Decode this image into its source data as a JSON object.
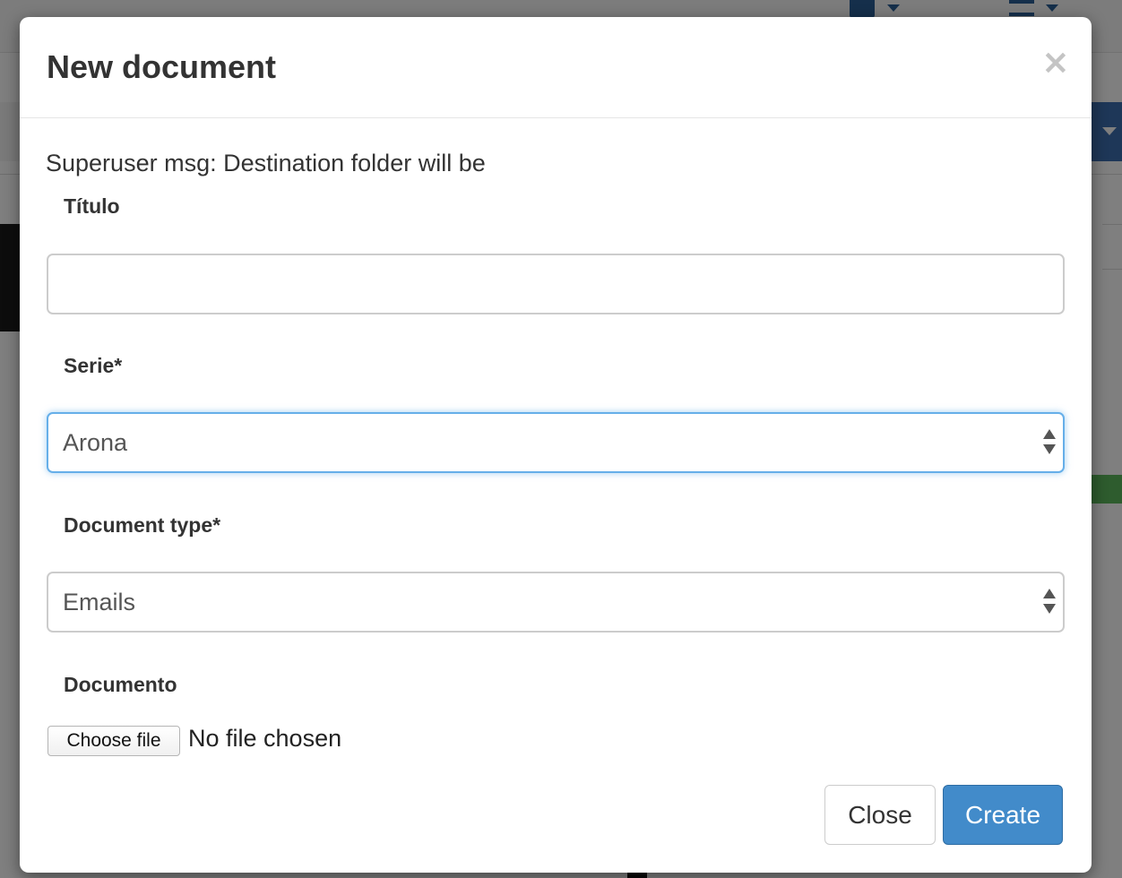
{
  "modal": {
    "title": "New document",
    "close_glyph": "×",
    "superuser_message": "Superuser msg: Destination folder will be"
  },
  "fields": {
    "titulo": {
      "label": "Título",
      "value": "",
      "placeholder": ""
    },
    "serie": {
      "label": "Serie*",
      "selected": "Arona",
      "focused": true
    },
    "document_type": {
      "label": "Document type*",
      "selected": "Emails"
    },
    "documento": {
      "label": "Documento",
      "button_label": "Choose file",
      "status": "No file chosen"
    }
  },
  "footer": {
    "close_label": "Close",
    "create_label": "Create"
  },
  "colors": {
    "primary": "#428bca",
    "focus_border": "#66afe9",
    "text": "#333333"
  },
  "icons": {
    "close": "close-icon",
    "select_arrows": "select-arrows-icon"
  }
}
